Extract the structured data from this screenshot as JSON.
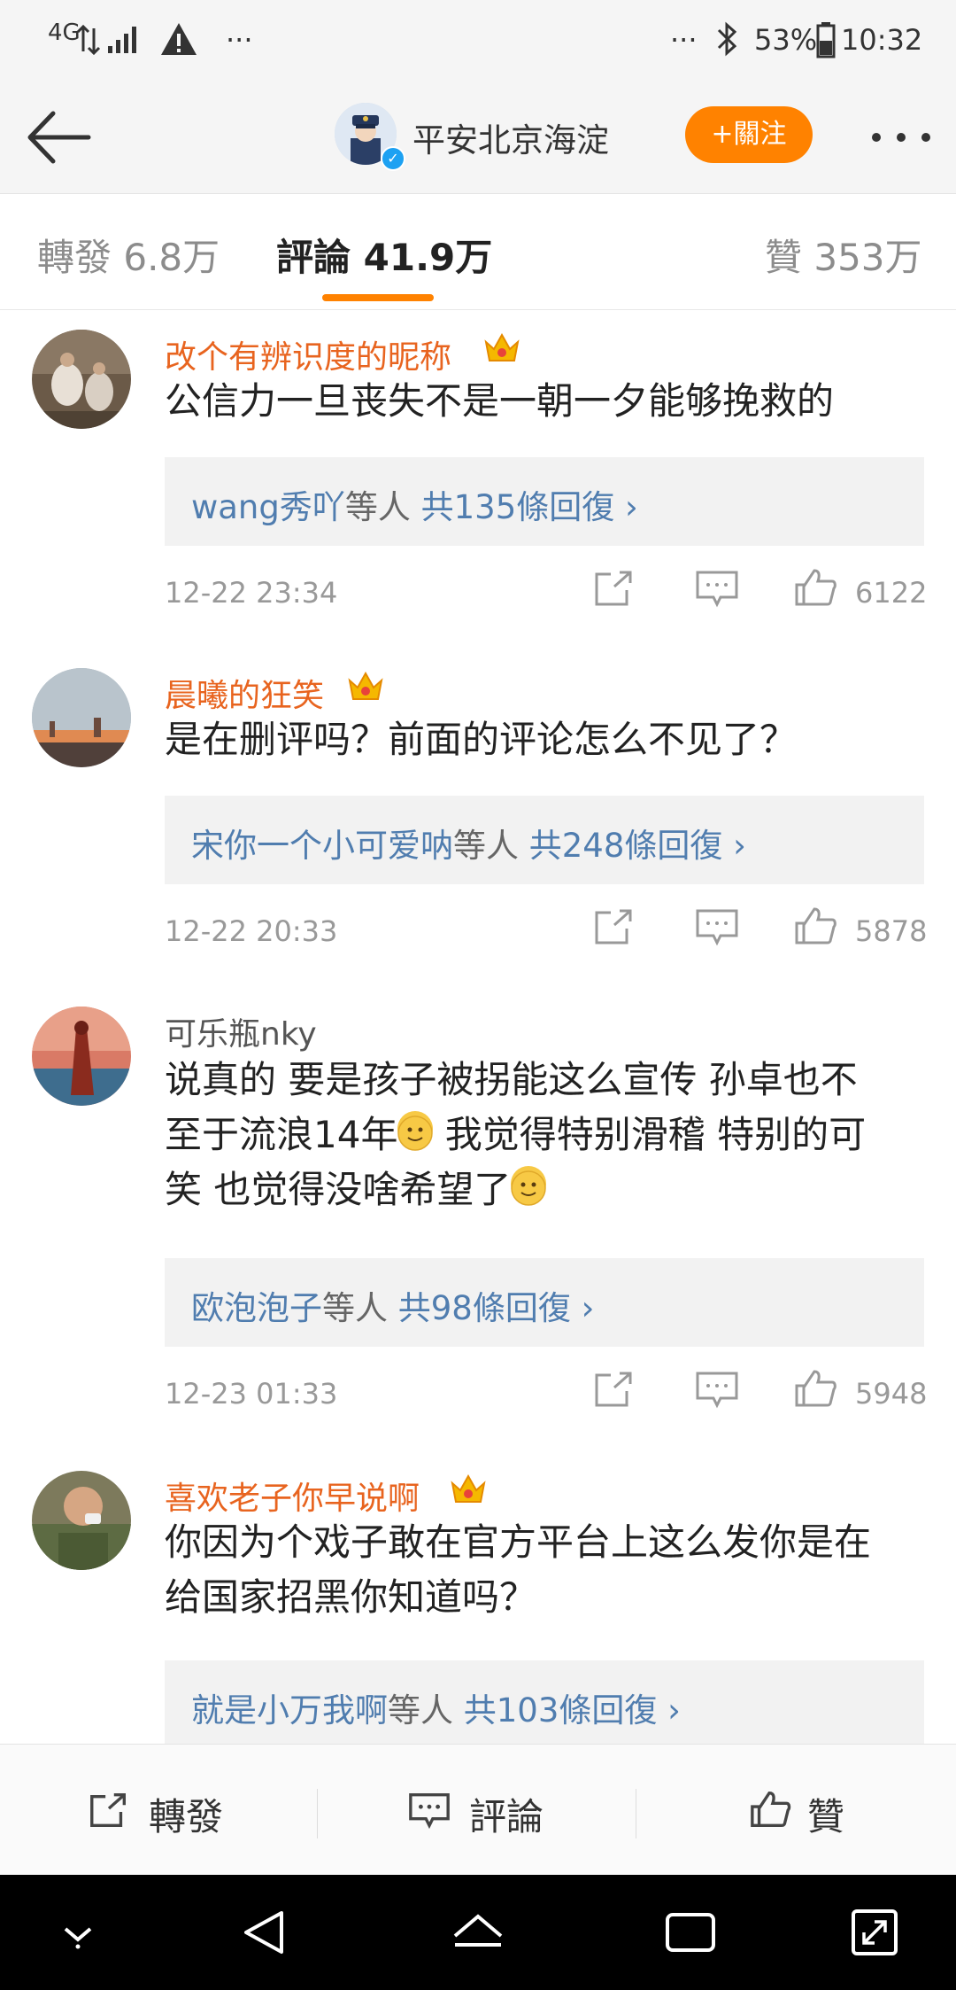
{
  "status_bar": {
    "network": "4G",
    "more_left": "···",
    "more_right": "···",
    "battery": "53%",
    "time": "10:32"
  },
  "header": {
    "account_name": "平安北京海淀",
    "follow_label": "+關注"
  },
  "tabs": {
    "repost": "轉發 6.8万",
    "comments": "評論 41.9万",
    "likes": "贊 353万"
  },
  "comments": [
    {
      "username": "改个有辨识度的昵称",
      "vip": true,
      "text": "公信力一旦丧失不是一朝一夕能够挽救的",
      "reply_user": "wang秀吖",
      "reply_mid": "等人",
      "reply_count": "共135條回復",
      "time": "12-22 23:34",
      "likes": "6122"
    },
    {
      "username": "晨曦的狂笑",
      "vip": true,
      "text": "是在删评吗？前面的评论怎么不见了？",
      "reply_user": "宋你一个小可爱呐",
      "reply_mid": "等人",
      "reply_count": "共248條回復",
      "time": "12-22 20:33",
      "likes": "5878"
    },
    {
      "username": "可乐瓶nky",
      "vip": false,
      "text_line1": "说真的 要是孩子被拐能这么宣传 孙卓也不",
      "text_line2a": "至于流浪14年",
      "text_line2b": " 我觉得特别滑稽 特别的可",
      "text_line3": "笑 也觉得没啥希望了",
      "reply_user": "欧泡泡子",
      "reply_mid": "等人",
      "reply_count": "共98條回復",
      "time": "12-23 01:33",
      "likes": "5948"
    },
    {
      "username": "喜欢老子你早说啊",
      "vip": true,
      "text_line1": "你因为个戏子敢在官方平台上这么发你是在",
      "text_line2": "给国家招黑你知道吗？",
      "reply_user": "就是小万我啊",
      "reply_mid": "等人",
      "reply_count": "共103條回復"
    }
  ],
  "action_bar": {
    "repost": "轉發",
    "comment": "評論",
    "like": "贊"
  },
  "colors": {
    "accent": "#ff8200",
    "vip_name": "#e8641f",
    "link": "#507daf"
  }
}
